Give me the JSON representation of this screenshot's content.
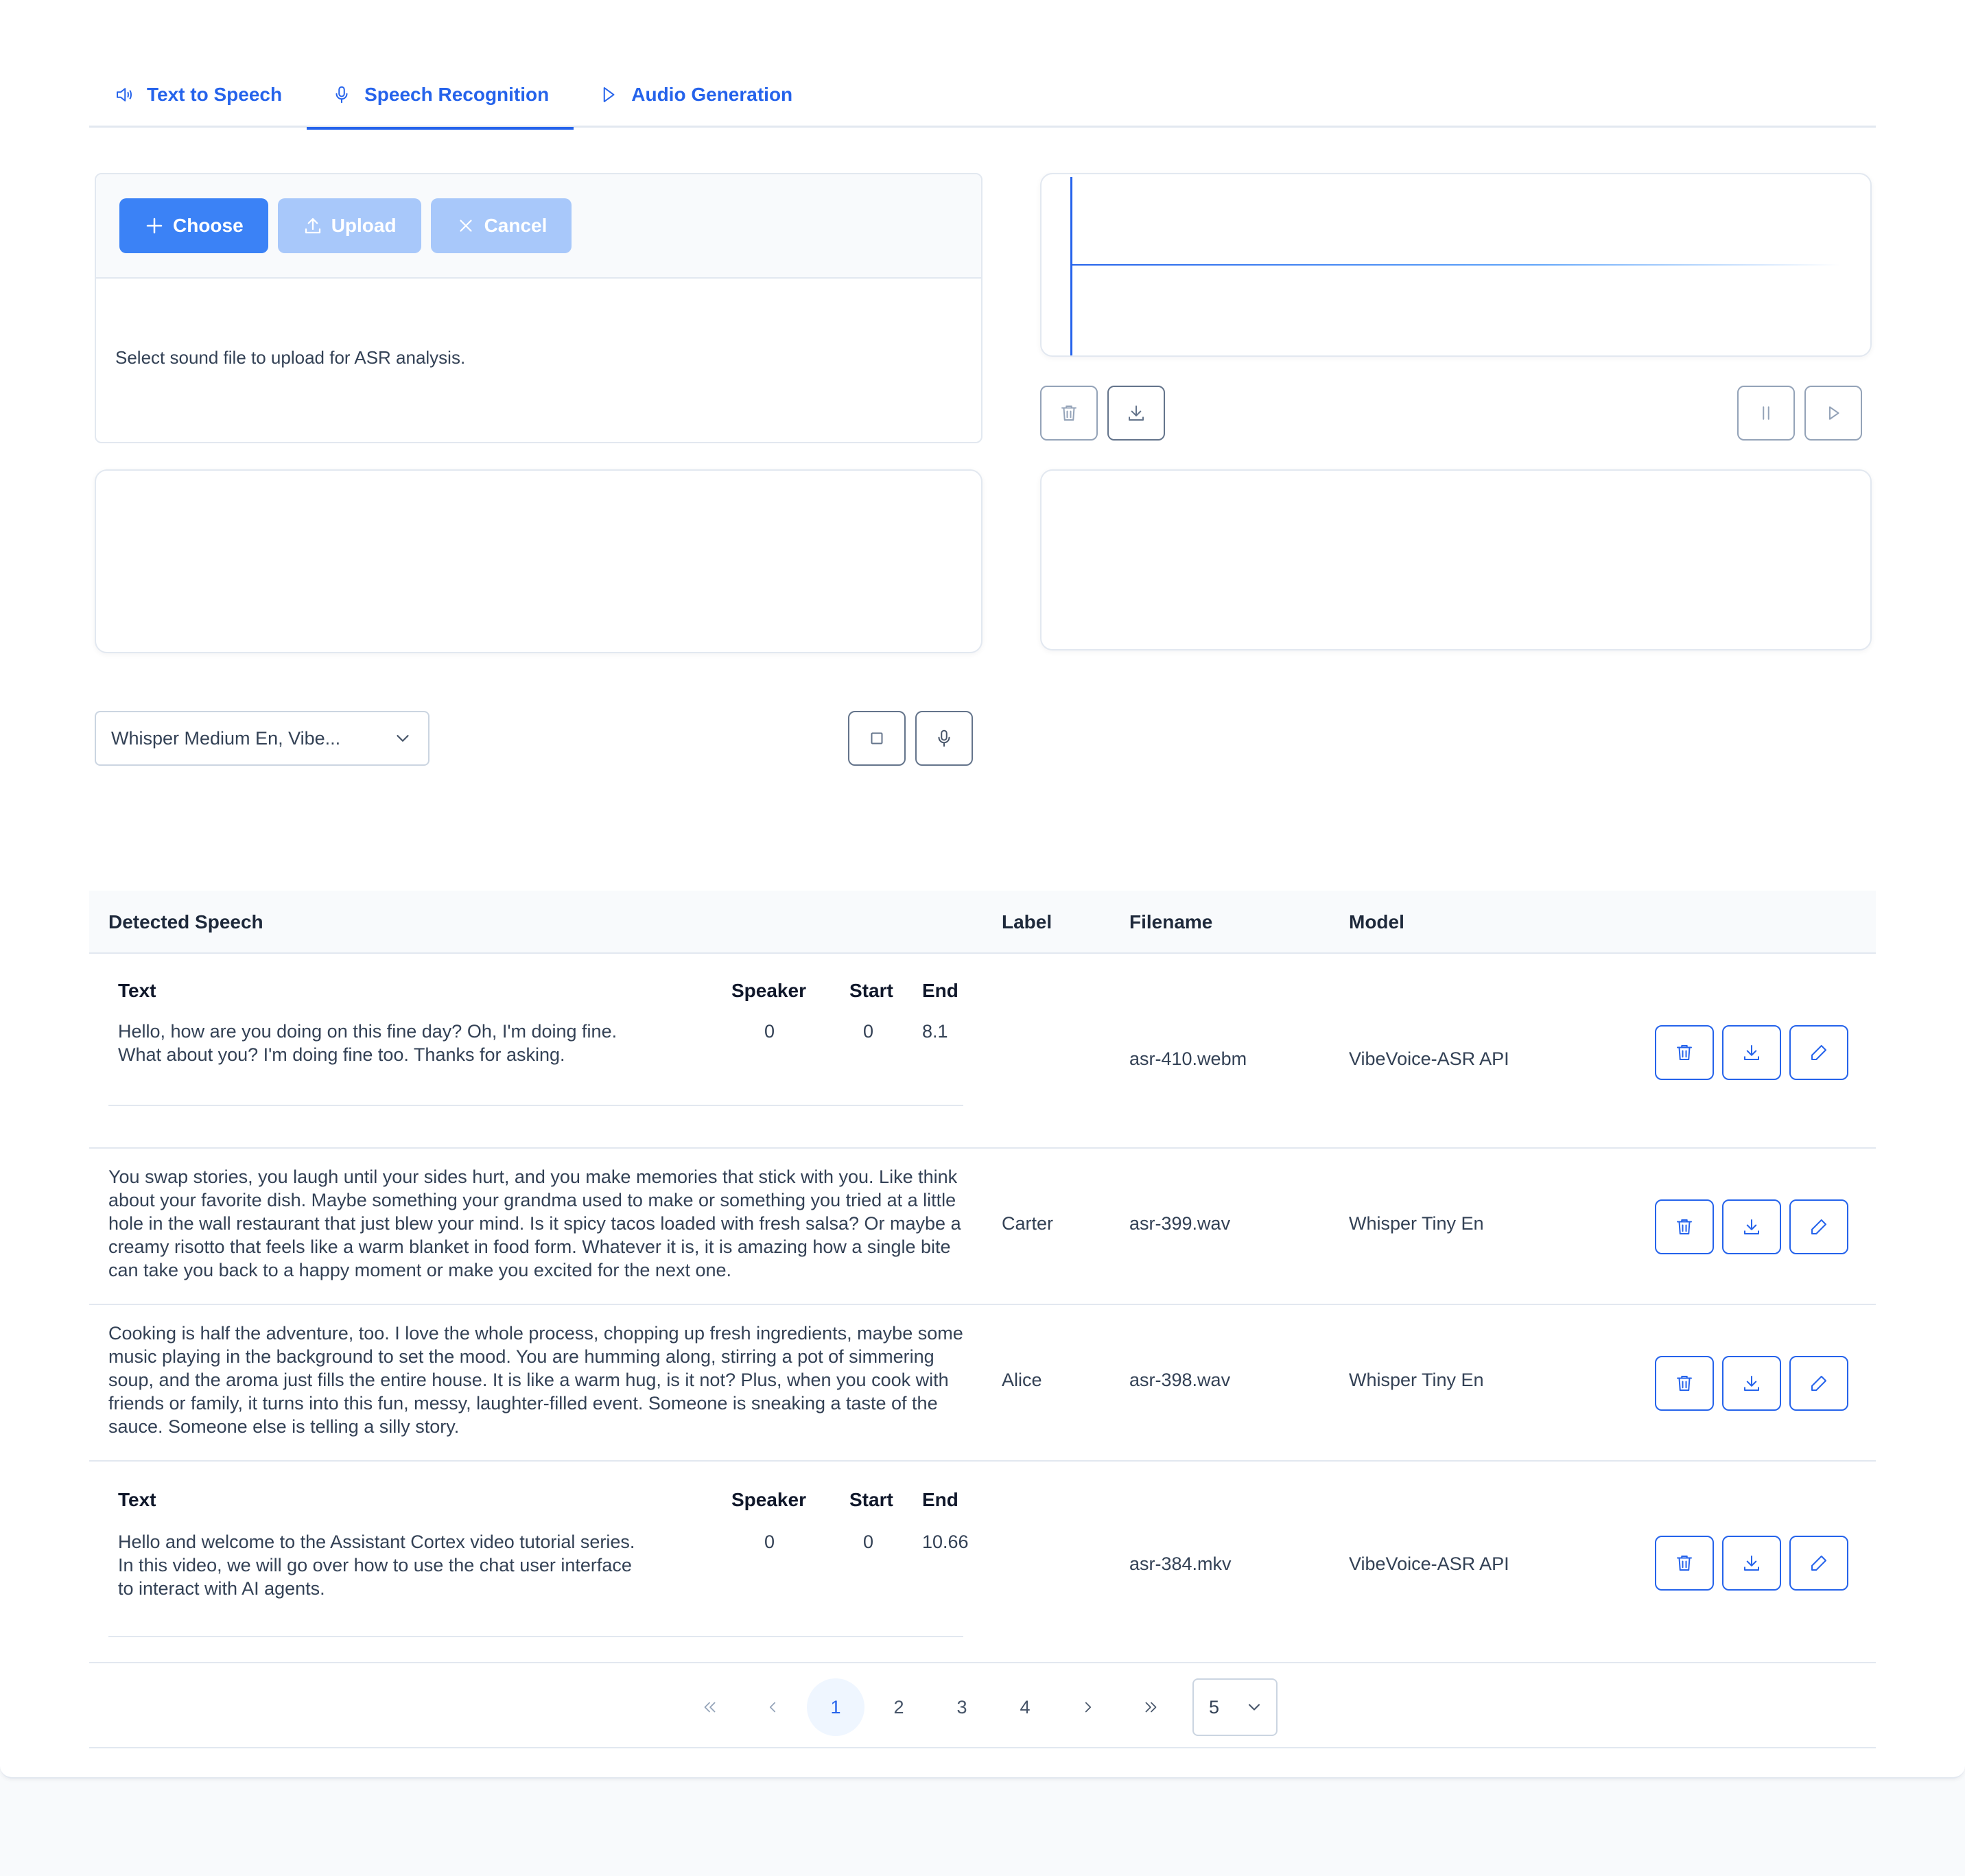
{
  "tabs": [
    {
      "label": "Text to Speech",
      "icon": "speaker-icon"
    },
    {
      "label": "Speech Recognition",
      "icon": "microphone-icon",
      "active": true
    },
    {
      "label": "Audio Generation",
      "icon": "play-icon"
    }
  ],
  "upload": {
    "choose_label": "Choose",
    "upload_label": "Upload",
    "cancel_label": "Cancel",
    "message": "Select sound file to upload for ASR analysis."
  },
  "model_select": {
    "value": "Whisper Medium En, Vibe..."
  },
  "table": {
    "headers": {
      "speech": "Detected Speech",
      "label": "Label",
      "filename": "Filename",
      "model": "Model"
    },
    "nested_headers": {
      "text": "Text",
      "speaker": "Speaker",
      "start": "Start",
      "end": "End"
    },
    "rows": [
      {
        "segments": [
          {
            "text_line1": "Hello, how are you doing on this fine day? Oh, I'm doing fine.",
            "text_line2": "What about you? I'm doing fine too. Thanks for asking.",
            "text_line3": "",
            "speaker": "0",
            "start": "0",
            "end": "8.1"
          }
        ],
        "label": "",
        "filename": "asr-410.webm",
        "model": "VibeVoice-ASR API"
      },
      {
        "text": "You swap stories, you laugh until your sides hurt, and you make memories that stick with you. Like think about your favorite dish. Maybe something your grandma used to make or something you tried at a little hole in the wall restaurant that just blew your mind. Is it spicy tacos loaded with fresh salsa? Or maybe a creamy risotto that feels like a warm blanket in food form. Whatever it is, it is amazing how a single bite can take you back to a happy moment or make you excited for the next one.",
        "label": "Carter",
        "filename": "asr-399.wav",
        "model": "Whisper Tiny En"
      },
      {
        "text": "Cooking is half the adventure, too. I love the whole process, chopping up fresh ingredients, maybe some music playing in the background to set the mood. You are humming along, stirring a pot of simmering soup, and the aroma just fills the entire house. It is like a warm hug, is it not? Plus, when you cook with friends or family, it turns into this fun, messy, laughter-filled event. Someone is sneaking a taste of the sauce. Someone else is telling a silly story.",
        "label": "Alice",
        "filename": "asr-398.wav",
        "model": "Whisper Tiny En"
      },
      {
        "segments": [
          {
            "text_line1": "Hello and welcome to the Assistant Cortex video tutorial series.",
            "text_line2": "In this video, we will go over how to use the chat user interface",
            "text_line3": "to interact with AI agents.",
            "speaker": "0",
            "start": "0",
            "end": "10.66"
          }
        ],
        "label": "",
        "filename": "asr-384.mkv",
        "model": "VibeVoice-ASR API"
      }
    ]
  },
  "pagination": {
    "pages": [
      "1",
      "2",
      "3",
      "4"
    ],
    "current": "1",
    "rows_per_page": "5"
  },
  "colors": {
    "accent": "#2563eb",
    "primary_button": "#3b82f6",
    "disabled_button": "#a8c8fa",
    "border": "#e2e8f0"
  }
}
